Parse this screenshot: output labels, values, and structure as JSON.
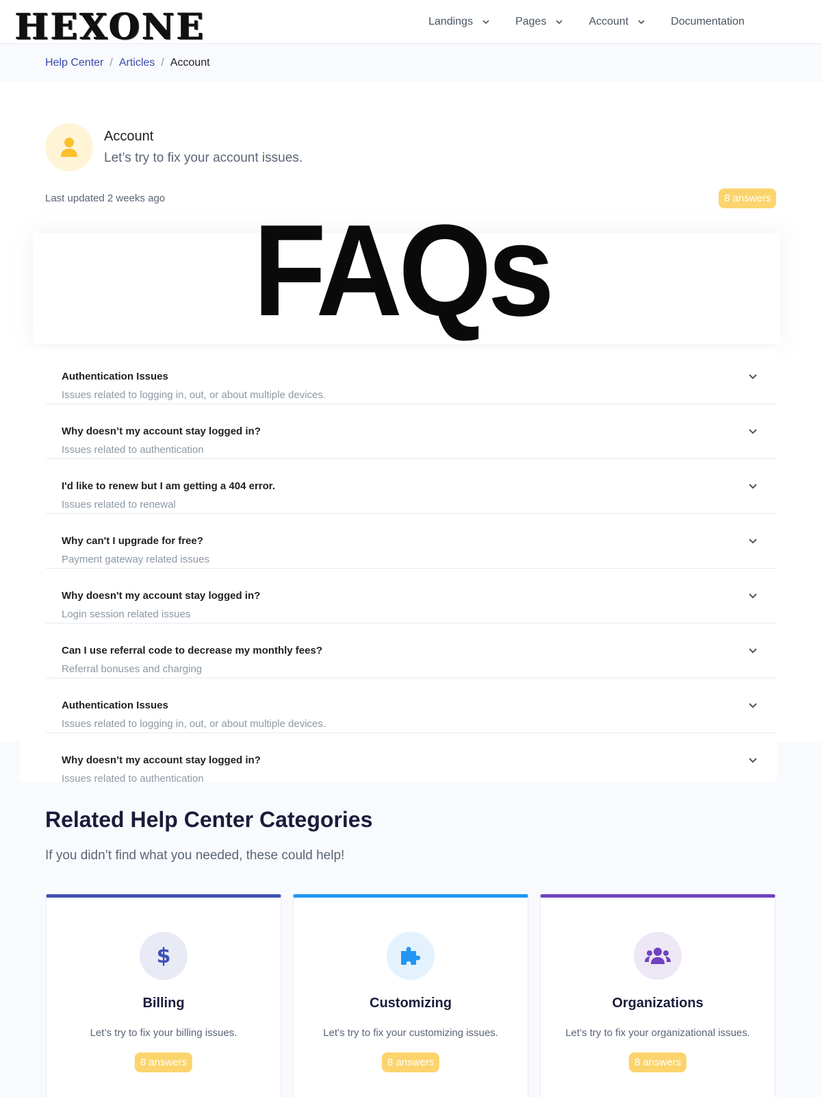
{
  "header": {
    "logo_text": "HEXONE",
    "nav": [
      {
        "label": "Landings",
        "has_dropdown": true
      },
      {
        "label": "Pages",
        "has_dropdown": true
      },
      {
        "label": "Account",
        "has_dropdown": true
      },
      {
        "label": "Documentation",
        "has_dropdown": false
      }
    ]
  },
  "breadcrumb": {
    "items": [
      "Help Center",
      "Articles"
    ],
    "current": "Account",
    "separator": "/"
  },
  "account": {
    "icon": "user-icon",
    "title": "Account",
    "subtitle": "Let’s try to fix your account issues.",
    "last_updated": "Last updated 2 weeks ago",
    "answers_badge": "8 answers"
  },
  "faq_heading": "FAQs",
  "faqs": [
    {
      "question": "Authentication Issues",
      "answer": "Issues related to logging in, out, or about multiple devices."
    },
    {
      "question": "Why doesn’t my account stay logged in?",
      "answer": "Issues related to authentication"
    },
    {
      "question": "I'd like to renew but I am getting a 404 error.",
      "answer": "Issues related to renewal"
    },
    {
      "question": "Why can't I upgrade for free?",
      "answer": "Payment gateway related issues"
    },
    {
      "question": "Why doesn't my account stay logged in?",
      "answer": "Login session related issues"
    },
    {
      "question": "Can I use referral code to decrease my monthly fees?",
      "answer": "Referral bonuses and charging"
    },
    {
      "question": "Authentication Issues",
      "answer": "Issues related to logging in, out, or about multiple devices."
    },
    {
      "question": "Why doesn’t my account stay logged in?",
      "answer": "Issues related to authentication"
    }
  ],
  "related": {
    "title": "Related Help Center Categories",
    "subtitle": "If you didn’t find what you needed, these could help!",
    "categories": [
      {
        "name": "Billing",
        "description": "Let’s try to fix your billing issues.",
        "badge": "8 answers",
        "icon": "dollar-icon",
        "accent": "#3f51b5",
        "icon_bg": "#e8eaf6"
      },
      {
        "name": "Customizing",
        "description": "Let’s try to fix your customizing issues.",
        "badge": "8 answers",
        "icon": "puzzle-icon",
        "accent": "#2196f3",
        "icon_bg": "#e3f2fd"
      },
      {
        "name": "Organizations",
        "description": "Let’s try to fix your organizational issues.",
        "badge": "8 answers",
        "icon": "users-icon",
        "accent": "#6f42c1",
        "icon_bg": "#ede7f6"
      }
    ]
  },
  "colors": {
    "link": "#3949ab",
    "badge": "#fbd46d",
    "muted": "#8c98a4"
  }
}
